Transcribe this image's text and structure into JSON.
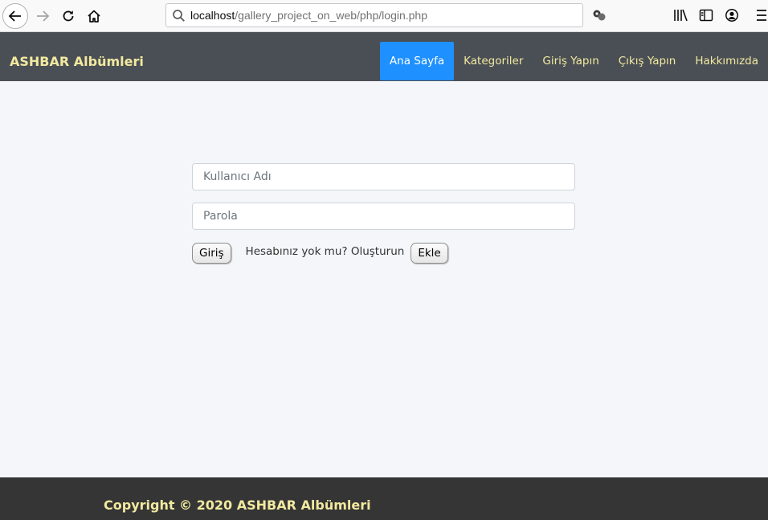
{
  "browser": {
    "url_host": "localhost",
    "url_path": "/gallery_project_on_web/php/login.php",
    "icons": [
      "back-arrow-icon",
      "forward-arrow-icon",
      "reload-icon",
      "home-icon",
      "search-icon",
      "extension-icon",
      "library-icon",
      "sidebar-icon",
      "account-icon",
      "hamburger-menu-icon"
    ]
  },
  "navbar": {
    "brand": "ASHBAR Albümleri",
    "links": [
      {
        "label": "Ana Sayfa",
        "active": true
      },
      {
        "label": "Kategoriler"
      },
      {
        "label": "Giriş Yapın"
      },
      {
        "label": "Çıkış Yapın"
      },
      {
        "label": "Hakkımızda"
      }
    ]
  },
  "login_form": {
    "username_placeholder": "Kullanıcı Adı",
    "password_placeholder": "Parola",
    "login_button": "Giriş",
    "signup_prompt": "Hesabınız yok mu? Oluşturun",
    "signup_button": "Ekle"
  },
  "footer": {
    "copyright": "Copyright © 2020 ASHBAR Albümleri"
  },
  "colors": {
    "navbar_bg": "#4a4f55",
    "accent_text": "#f2e9a0",
    "active_link_bg": "#1e90ff",
    "main_bg": "#f4f6fa",
    "footer_bg": "#353535"
  }
}
